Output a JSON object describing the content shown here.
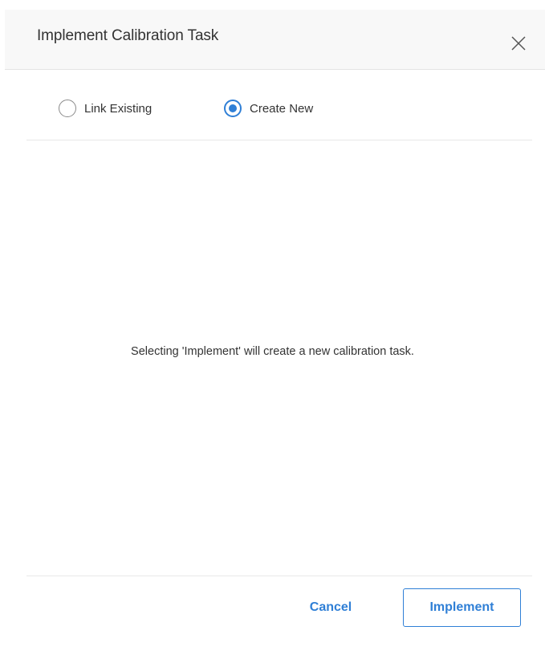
{
  "dialog": {
    "title": "Implement Calibration Task",
    "close_icon": "close-icon"
  },
  "options": {
    "link_existing_label": "Link Existing",
    "create_new_label": "Create New",
    "selected": "Create New"
  },
  "message": "Selecting 'Implement' will create a new calibration task.",
  "footer": {
    "cancel_label": "Cancel",
    "implement_label": "Implement"
  },
  "colors": {
    "accent": "#2f7fd6",
    "text": "#333333",
    "header_bg": "#f8f8f8"
  }
}
